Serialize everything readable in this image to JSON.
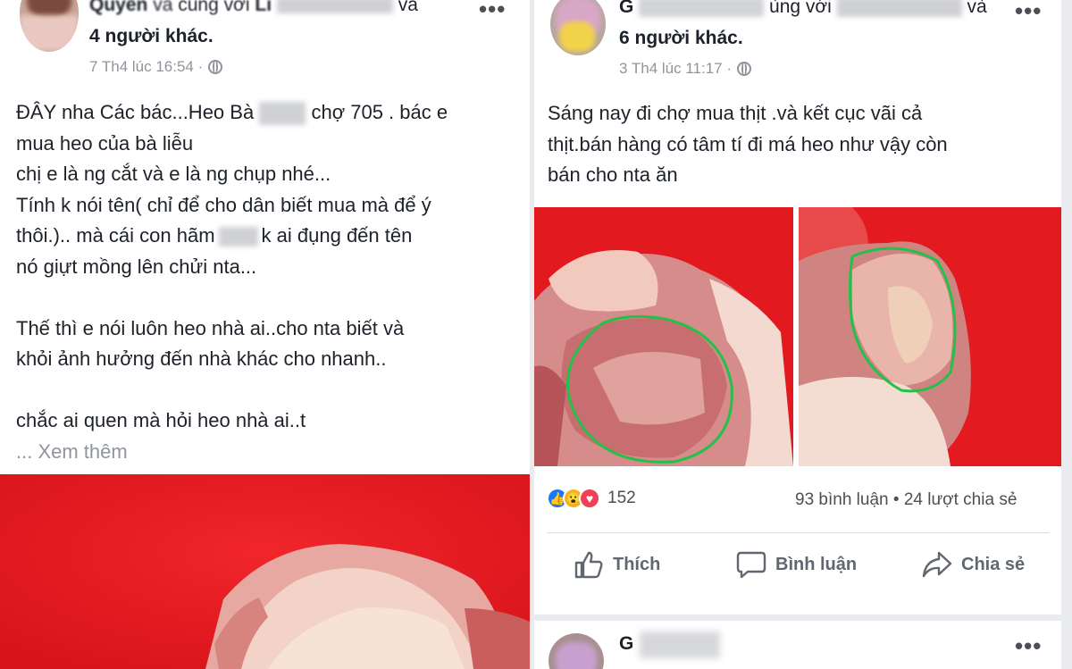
{
  "left_post": {
    "author_part1": "Quyên",
    "author_mid": "và",
    "author_with": "cùng với",
    "author_name2": "Li",
    "author_and": "và",
    "others": "4 người khác.",
    "timestamp": "7 Th4 lúc 16:54 ·",
    "body": [
      "ĐÂY nha Các bác...Heo Bà",
      "chợ 705 . bác e",
      "mua heo của bà liễu",
      "chị e là ng cắt và e là ng chụp nhé...",
      "Tính k nói tên( chỉ để cho dân biết mua mà để ý",
      "thôi.).. mà cái con hãm",
      "k ai đụng đến tên",
      "nó giựt mồng lên chửi nta...",
      "Thế thì e nói luôn heo nhà ai..cho nta biết và",
      "khỏi ảnh hưởng đến nhà khác cho nhanh..",
      "chắc ai quen mà hỏi heo nhà ai..t"
    ],
    "see_more": "... Xem thêm",
    "more_icon": "more-dots-icon"
  },
  "right_post": {
    "author_initial": "G",
    "author_with": "ùng với",
    "author_and": "và",
    "others": "6 người khác.",
    "timestamp": "3 Th4 lúc 11:17 ·",
    "body": [
      "Sáng nay đi chợ mua thịt .và kết cục vãi cả",
      "thịt.bán hàng có tâm tí đi má heo như vậy còn",
      "bán cho nta ăn"
    ],
    "reaction_count": "152",
    "comments": "93 bình luận",
    "shares": "24 lượt chia sẻ",
    "actions": {
      "like": "Thích",
      "comment": "Bình luận",
      "share": "Chia sẻ"
    }
  },
  "third_post": {
    "author_initial": "G"
  },
  "colors": {
    "meat_bg": "#e8181e",
    "like_blue": "#1877f2",
    "heart_red": "#f33e58",
    "circle_green": "#22c24a"
  }
}
